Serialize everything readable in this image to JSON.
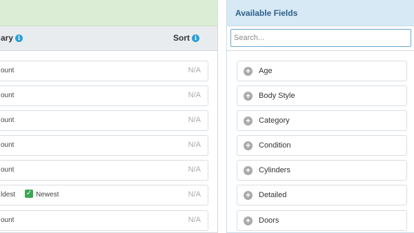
{
  "left": {
    "summary_label": "ary",
    "sort_label": "Sort",
    "rows": [
      {
        "text": "ount",
        "sort": "N/A"
      },
      {
        "text": "ount",
        "sort": "N/A"
      },
      {
        "text": "ount",
        "sort": "N/A"
      },
      {
        "text": "ount",
        "sort": "N/A"
      },
      {
        "text": "ount",
        "sort": "N/A"
      },
      {
        "text": "ldest",
        "option2": "Newest",
        "sort": "N/A"
      },
      {
        "text": "ount",
        "sort": "N/A"
      }
    ]
  },
  "right": {
    "title": "Available Fields",
    "search_placeholder": "Search...",
    "fields": [
      "Age",
      "Body Style",
      "Category",
      "Condition",
      "Cylinders",
      "Detailed",
      "Doors"
    ]
  },
  "colors": {
    "left_top_bg": "#dcedd6",
    "right_header_bg": "#d6e9f5",
    "title_color": "#2f5f88",
    "info_icon": "#2a9fd6",
    "check_green": "#3aa655"
  }
}
